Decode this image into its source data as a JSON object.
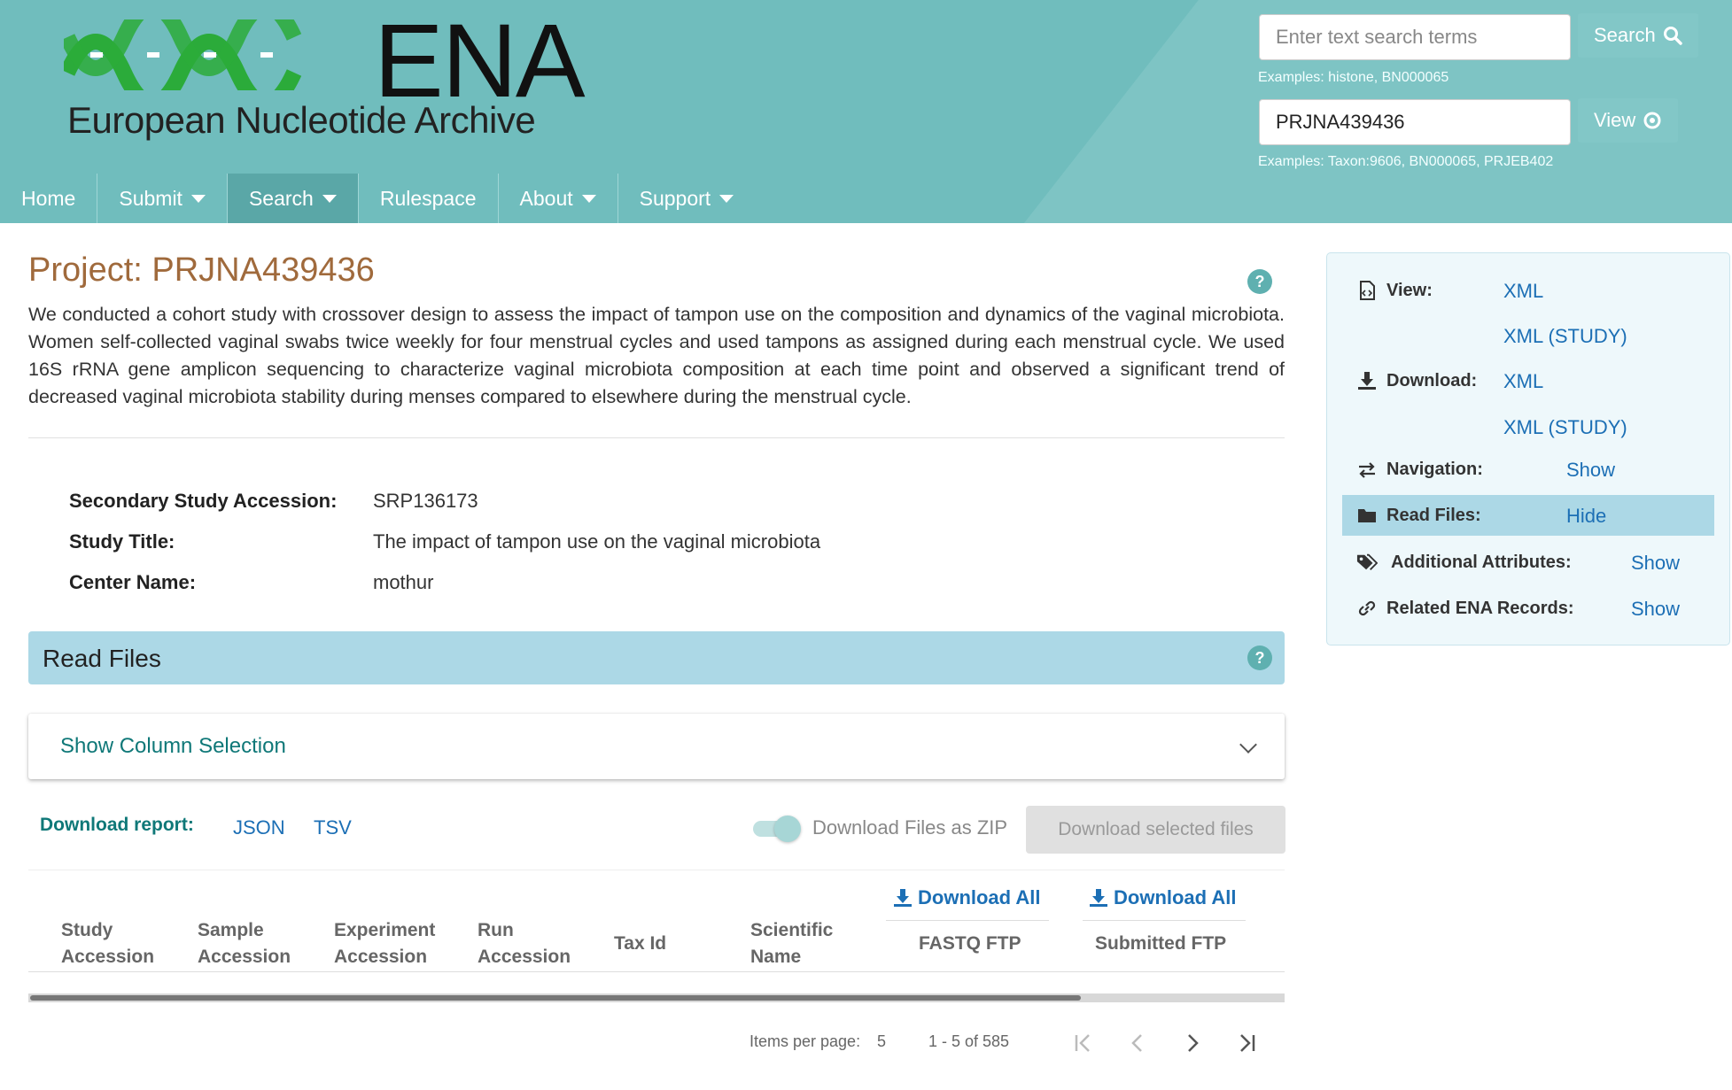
{
  "header": {
    "logo_text": "ENA",
    "logo_subtitle": "European Nucleotide Archive",
    "text_search": {
      "placeholder": "Enter text search terms",
      "button_label": "Search",
      "examples": "Examples: histone, BN000065"
    },
    "view_search": {
      "value": "PRJNA439436",
      "button_label": "View",
      "examples": "Examples: Taxon:9606, BN000065, PRJEB402"
    },
    "nav": [
      {
        "label": "Home",
        "has_dropdown": false
      },
      {
        "label": "Submit",
        "has_dropdown": true
      },
      {
        "label": "Search",
        "has_dropdown": true,
        "active": true
      },
      {
        "label": "Rulespace",
        "has_dropdown": false
      },
      {
        "label": "About",
        "has_dropdown": true
      },
      {
        "label": "Support",
        "has_dropdown": true
      }
    ],
    "colors": {
      "header_bg": "#70bdbd",
      "logo_green": "#2bab3a"
    }
  },
  "project": {
    "title": "Project: PRJNA439436",
    "description": "We conducted a cohort study with crossover design to assess the impact of tampon use on the composition and dynamics of the vaginal microbiota. Women self-collected vaginal swabs twice weekly for four menstrual cycles and used tampons as assigned during each menstrual cycle. We used 16S rRNA gene amplicon sequencing to characterize vaginal microbiota composition at each time point and observed a significant trend of decreased vaginal microbiota stability during menses compared to elsewhere during the menstrual cycle.",
    "metadata": [
      {
        "label": "Secondary Study Accession:",
        "value": "SRP136173"
      },
      {
        "label": "Study Title:",
        "value": "The impact of tampon use on the vaginal microbiota"
      },
      {
        "label": "Center Name:",
        "value": "mothur"
      }
    ],
    "help_icon": "?"
  },
  "read_files": {
    "section_title": "Read Files",
    "column_selection_label": "Show Column Selection",
    "download_report_label": "Download report:",
    "report_formats": [
      "JSON",
      "TSV"
    ],
    "zip_toggle_label": "Download Files as ZIP",
    "download_selected_label": "Download selected files",
    "download_all_label": "Download All",
    "columns": [
      {
        "line1": "Study",
        "line2": "Accession"
      },
      {
        "line1": "Sample",
        "line2": "Accession"
      },
      {
        "line1": "Experiment",
        "line2": "Accession"
      },
      {
        "line1": "Run",
        "line2": "Accession"
      },
      {
        "line1": "Tax Id",
        "line2": ""
      },
      {
        "line1": "Scientific",
        "line2": "Name"
      },
      {
        "line1": "FASTQ FTP",
        "line2": ""
      },
      {
        "line1": "Submitted FTP",
        "line2": ""
      }
    ],
    "pagination": {
      "items_per_page_label": "Items per page:",
      "items_per_page": "5",
      "range_label": "1 - 5 of 585"
    }
  },
  "sidebar": {
    "view_label": "View:",
    "view_links": [
      "XML",
      "XML (STUDY)"
    ],
    "download_label": "Download:",
    "download_links": [
      "XML",
      "XML (STUDY)"
    ],
    "toggles": [
      {
        "label": "Navigation:",
        "action": "Show",
        "icon": "arrows-exchange-icon"
      },
      {
        "label": "Read Files:",
        "action": "Hide",
        "icon": "folder-icon",
        "highlight": true
      },
      {
        "label": "Additional Attributes:",
        "action": "Show",
        "icon": "tags-icon"
      },
      {
        "label": "Related ENA Records:",
        "action": "Show",
        "icon": "link-icon"
      }
    ]
  }
}
